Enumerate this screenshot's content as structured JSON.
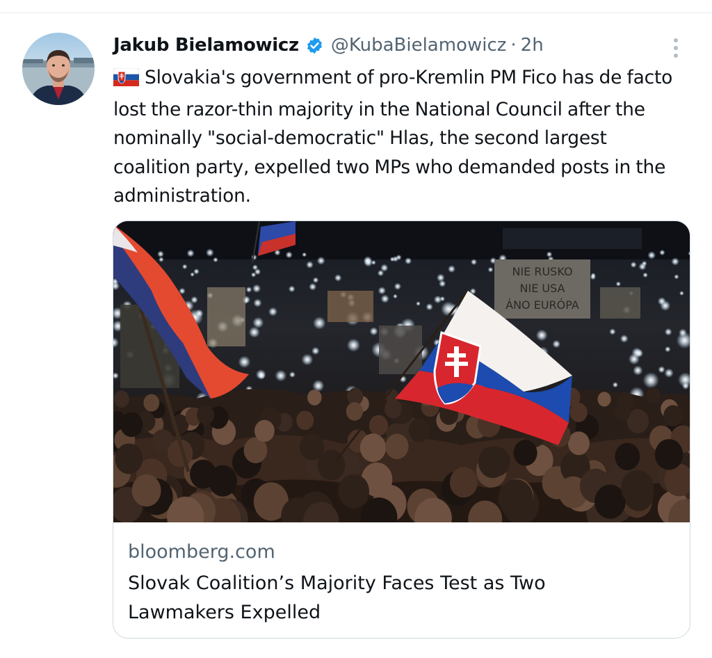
{
  "tweet": {
    "author": {
      "display_name": "Jakub Bielamowicz",
      "handle": "@KubaBielamowicz",
      "separator": "·",
      "time": "2h",
      "verified_icon": "verified-badge-icon",
      "avatar_icon": "avatar"
    },
    "more_icon": "more-options-icon",
    "flag_icon": "slovakia-flag-emoji",
    "text": "Slovakia's government of pro-Kremlin PM Fico has de facto lost the razor-thin majority in the National Council after the nominally \"social-democratic\" Hlas, the second largest coalition party, expelled two MPs who demanded posts in the administration.",
    "card": {
      "domain": "bloomberg.com",
      "title": "Slovak Coalition’s Majority Faces Test as Two Lawmakers Expelled",
      "image": {
        "description_icon": "protest-crowd-photo",
        "sign_lines": [
          "NIE RUSKO",
          "NIE USA",
          "ÁNO EURÓPA"
        ]
      }
    }
  },
  "colors": {
    "text_primary": "#0f1419",
    "text_secondary": "#536471",
    "verified_blue": "#1d9bf0",
    "border": "#cfd9de"
  }
}
